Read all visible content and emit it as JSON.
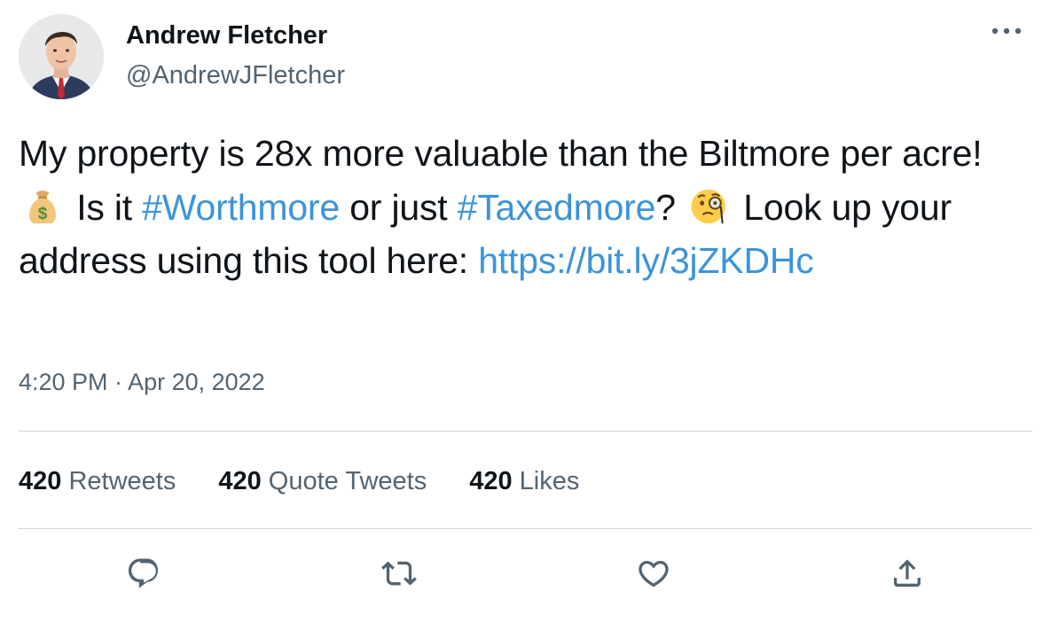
{
  "author": {
    "display_name": "Andrew Fletcher",
    "handle": "@AndrewJFletcher"
  },
  "tweet": {
    "segments": [
      {
        "type": "text",
        "value": "My property is 28x more valuable than the Biltmore per acre! "
      },
      {
        "type": "emoji",
        "icon": "money-bag-icon"
      },
      {
        "type": "text",
        "value": " Is it "
      },
      {
        "type": "link",
        "value": "#Worthmore"
      },
      {
        "type": "text",
        "value": " or just "
      },
      {
        "type": "link",
        "value": "#Taxedmore"
      },
      {
        "type": "text",
        "value": "? "
      },
      {
        "type": "emoji",
        "icon": "face-with-monocle-icon"
      },
      {
        "type": "text",
        "value": " Look up your address using this tool here: "
      },
      {
        "type": "link",
        "value": "https://bit.ly/3jZKDHc"
      }
    ],
    "timestamp": "4:20 PM · Apr 20, 2022"
  },
  "stats": [
    {
      "count": "420",
      "label": "Retweets"
    },
    {
      "count": "420",
      "label": "Quote Tweets"
    },
    {
      "count": "420",
      "label": "Likes"
    }
  ],
  "actions": [
    "reply-icon",
    "retweet-icon",
    "like-icon",
    "share-icon"
  ],
  "colors": {
    "text": "#0f1419",
    "secondary": "#536471",
    "link": "#3b94d9",
    "divider": "#cfd9de"
  }
}
